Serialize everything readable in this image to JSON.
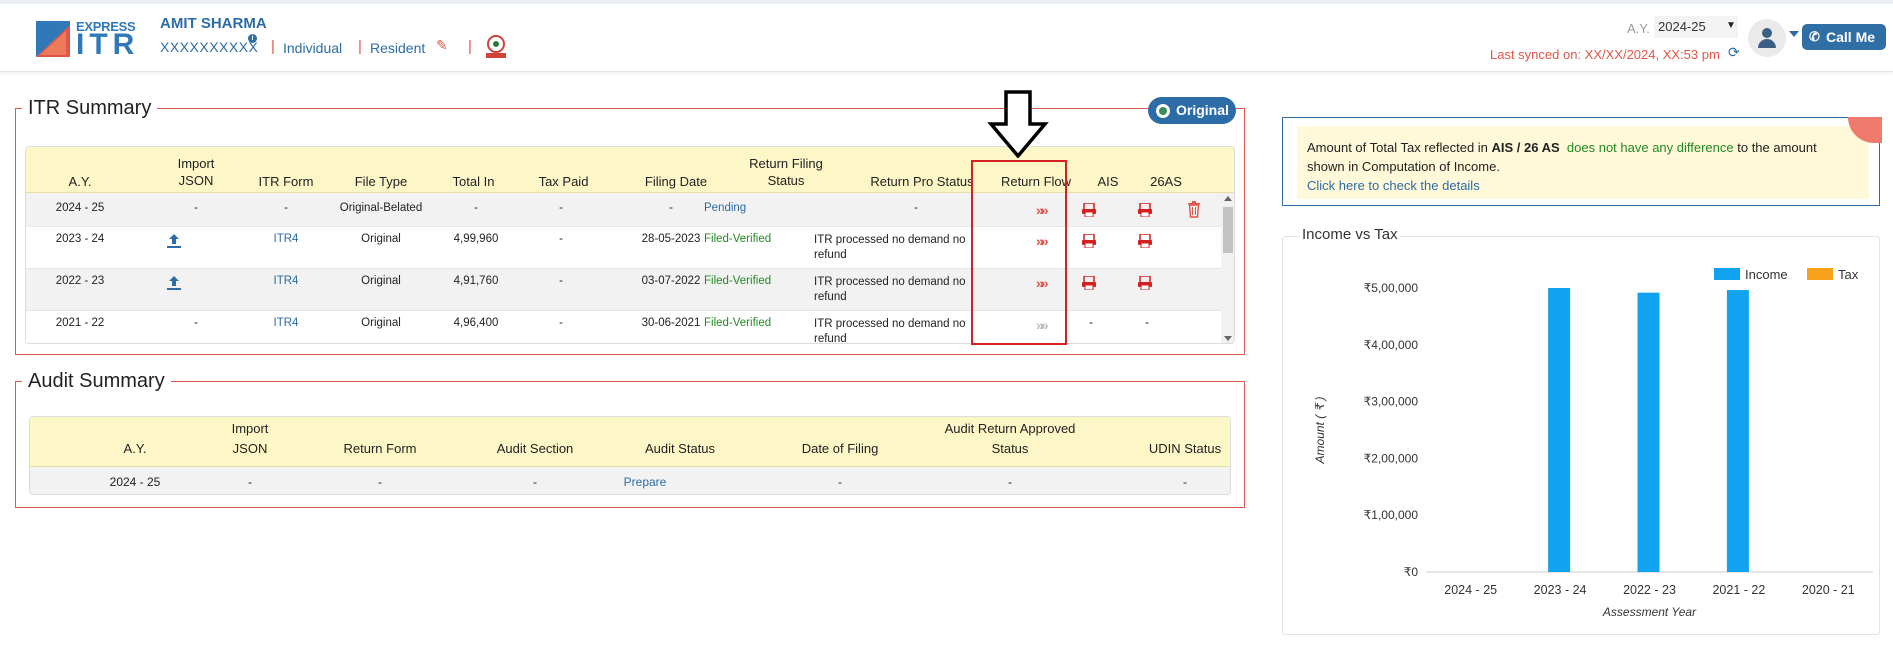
{
  "header": {
    "logo_express": "EXPRESS",
    "logo_itr": "ITR",
    "user_name": "AMIT SHARMA",
    "pan": "XXXXXXXXXX",
    "info": "i",
    "type": "Individual",
    "residency": "Resident",
    "ay_label": "A.Y.",
    "ay_value": "2024-25",
    "last_synced": "Last synced on: XX/XX/2024, XX:53 pm",
    "call_me": "Call Me",
    "colors": {
      "brand_blue": "#2c6ca7",
      "accent_red": "#e0564b"
    }
  },
  "itr_summary": {
    "title": "ITR Summary",
    "badge": "Original",
    "columns": [
      "A.Y.",
      "Import JSON",
      "ITR Form",
      "File Type",
      "Total In",
      "Tax Paid",
      "Filing Date",
      "Return Filing Status",
      "Return Pro Status",
      "Return Flow",
      "AIS",
      "26AS"
    ],
    "col_import_1": "Import",
    "col_import_2": "JSON",
    "col_status_1": "Return Filing",
    "col_status_2": "Status",
    "rows": [
      {
        "ay": "2024 - 25",
        "import": "-",
        "form": "-",
        "file_type": "Original-Belated",
        "total_in": "-",
        "tax_paid": "-",
        "filing_date": "-",
        "status": "Pending",
        "pro_status": "-",
        "pro_status_2": ""
      },
      {
        "ay": "2023 - 24",
        "import": "",
        "form": "ITR4",
        "file_type": "Original",
        "total_in": "4,99,960",
        "tax_paid": "-",
        "filing_date": "28-05-2023",
        "status": "Filed-Verified",
        "pro_status": "ITR processed no demand no",
        "pro_status_2": "refund"
      },
      {
        "ay": "2022 - 23",
        "import": "",
        "form": "ITR4",
        "file_type": "Original",
        "total_in": "4,91,760",
        "tax_paid": "-",
        "filing_date": "03-07-2022",
        "status": "Filed-Verified",
        "pro_status": "ITR processed no demand no",
        "pro_status_2": "refund"
      },
      {
        "ay": "2021 - 22",
        "import": "-",
        "form": "ITR4",
        "file_type": "Original",
        "total_in": "4,96,400",
        "tax_paid": "-",
        "filing_date": "30-06-2021",
        "status": "Filed-Verified",
        "pro_status": "ITR processed no demand no",
        "pro_status_2": "refund",
        "ais": "-",
        "26as": "-"
      }
    ],
    "flow_icon": "»»"
  },
  "audit_summary": {
    "title": "Audit Summary",
    "col_ay": "A.Y.",
    "col_import_1": "Import",
    "col_import_2": "JSON",
    "col_form": "Return Form",
    "col_section": "Audit Section",
    "col_status": "Audit Status",
    "col_date": "Date of Filing",
    "col_approved_1": "Audit Return Approved",
    "col_approved_2": "Status",
    "col_udin": "UDIN Status",
    "row": {
      "ay": "2024 - 25",
      "import": "-",
      "form": "-",
      "section": "-",
      "status": "Prepare",
      "date": "-",
      "approved": "-",
      "udin": "-"
    }
  },
  "ais_notice": {
    "text_1": "Amount of Total Tax reflected in ",
    "text_bold": "AIS / 26 AS",
    "text_green": "does not have any difference",
    "text_2": " to the amount",
    "text_3": "shown in Computation of Income.",
    "link": "Click here to check the details"
  },
  "chart_data": {
    "type": "bar",
    "title": "Income vs Tax",
    "xlabel": "Assessment Year",
    "ylabel": "Amount ( ₹ )",
    "categories": [
      "2024 - 25",
      "2023 - 24",
      "2022 - 23",
      "2021 - 22",
      "2020 - 21"
    ],
    "series": [
      {
        "name": "Income",
        "color": "#11a3f0",
        "values": [
          0,
          499960,
          491760,
          496400,
          0
        ]
      },
      {
        "name": "Tax",
        "color": "#f9a01b",
        "values": [
          0,
          0,
          0,
          0,
          0
        ]
      }
    ],
    "ylim": [
      0,
      500000
    ],
    "yticks": [
      "₹0",
      "₹1,00,000",
      "₹2,00,000",
      "₹3,00,000",
      "₹4,00,000",
      "₹5,00,000"
    ],
    "legend": "top-right",
    "grid": false
  }
}
